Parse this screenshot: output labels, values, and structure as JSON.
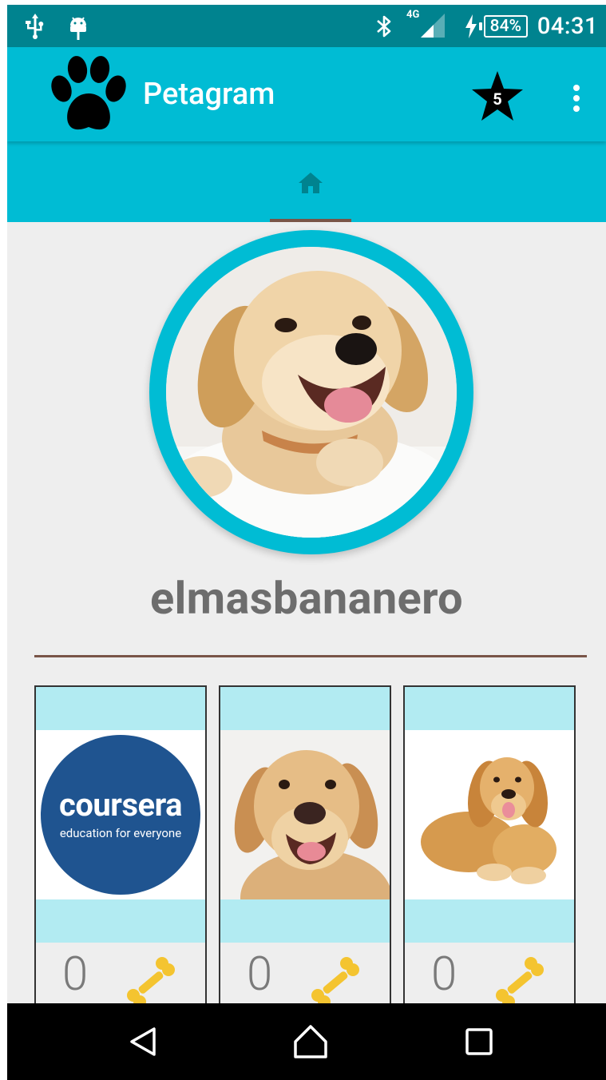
{
  "status_bar": {
    "network": "4G",
    "battery": "84%",
    "time": "04:31",
    "icons": [
      "usb-icon",
      "android-debug-icon",
      "bluetooth-icon",
      "signal-icon",
      "charging-icon",
      "battery-icon"
    ]
  },
  "app_bar": {
    "title": "Petagram",
    "logo_icon": "paw-icon",
    "favorites_count": "5",
    "favorites_icon": "star-icon",
    "menu_icon": "overflow-menu-icon"
  },
  "tabs": [
    {
      "icon": "home-icon",
      "selected": true
    }
  ],
  "profile": {
    "username": "elmasbananero",
    "avatar": "golden-retriever-puppy-photo"
  },
  "pets": [
    {
      "likes": "0",
      "image": "coursera-logo",
      "logo_text": "coursera",
      "tagline": "education for everyone",
      "like_icon": "bone-icon"
    },
    {
      "likes": "0",
      "image": "labrador-puppy-photo",
      "like_icon": "bone-icon"
    },
    {
      "likes": "0",
      "image": "golden-retriever-lying-photo",
      "like_icon": "bone-icon"
    }
  ],
  "nav_bar": {
    "buttons": [
      "back-icon",
      "home-icon",
      "recents-icon"
    ]
  },
  "colors": {
    "status_bar": "#00838f",
    "primary": "#00bcd4",
    "accent": "#795548",
    "card_band": "#b2ebf2",
    "background": "#eeeeee",
    "bone": "#f4c430"
  }
}
